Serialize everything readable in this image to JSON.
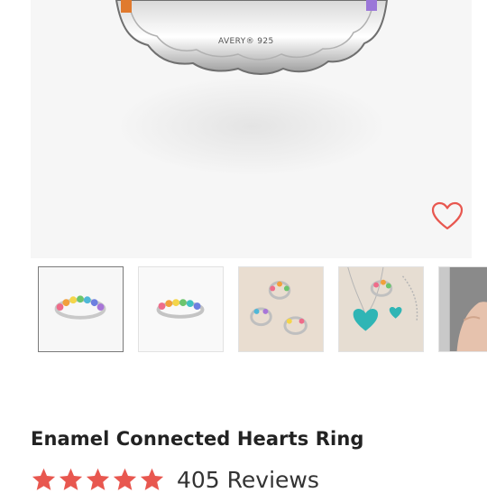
{
  "product": {
    "title": "Enamel Connected Hearts Ring",
    "engraving": "AVERY® 925",
    "rating_stars": 5,
    "reviews_label": "405 Reviews"
  },
  "gallery": {
    "thumbnails": [
      {
        "name": "rainbow-ring-front",
        "selected": true
      },
      {
        "name": "rainbow-ring-side",
        "selected": false
      },
      {
        "name": "rings-on-table",
        "selected": false
      },
      {
        "name": "turquoise-heart-necklace-set",
        "selected": false
      },
      {
        "name": "ring-on-hand",
        "selected": false
      }
    ]
  },
  "icons": {
    "favorite": "heart-outline-icon",
    "rating": "star-icon"
  },
  "colors": {
    "accent": "#e8574f",
    "title": "#222222",
    "hero_bg": "#f6f6f6"
  }
}
